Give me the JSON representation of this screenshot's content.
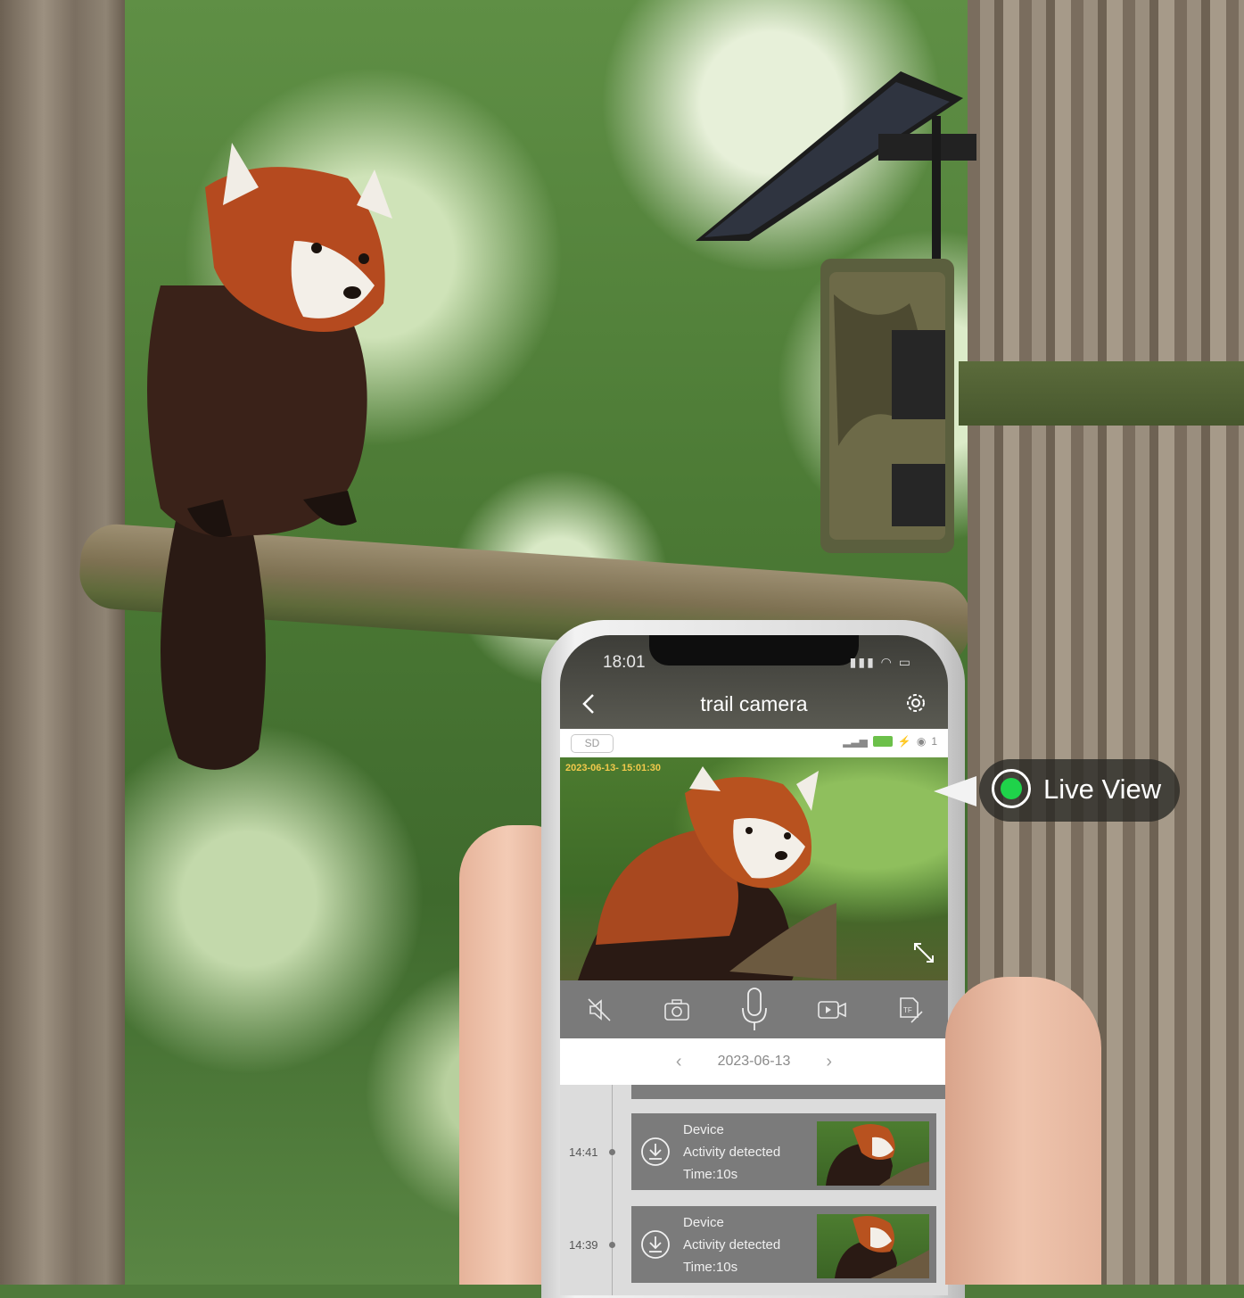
{
  "status_bar": {
    "time": "18:01"
  },
  "app": {
    "title": "trail camera",
    "storage_badge": "SD",
    "viewer_count": "1"
  },
  "video": {
    "timestamp": "2023-06-13- 15:01:30"
  },
  "controls": [
    {
      "name": "mute-icon"
    },
    {
      "name": "snapshot-icon"
    },
    {
      "name": "microphone-icon"
    },
    {
      "name": "record-icon"
    },
    {
      "name": "sd-card-icon"
    }
  ],
  "date_nav": {
    "date": "2023-06-13",
    "prev": "‹",
    "next": "›"
  },
  "events": [
    {
      "time": "14:41",
      "source": "Device",
      "message": "Activity detected",
      "duration": "Time:10s"
    },
    {
      "time": "14:39",
      "source": "Device",
      "message": "Activity detected",
      "duration": "Time:10s"
    }
  ],
  "callout": {
    "label": "Live View",
    "indicator_color": "#1fd34a"
  },
  "colors": {
    "header": "#4a4a44",
    "controls_bar": "#7a7a7a",
    "event_card": "#7b7b7b",
    "battery": "#6cc04a"
  }
}
